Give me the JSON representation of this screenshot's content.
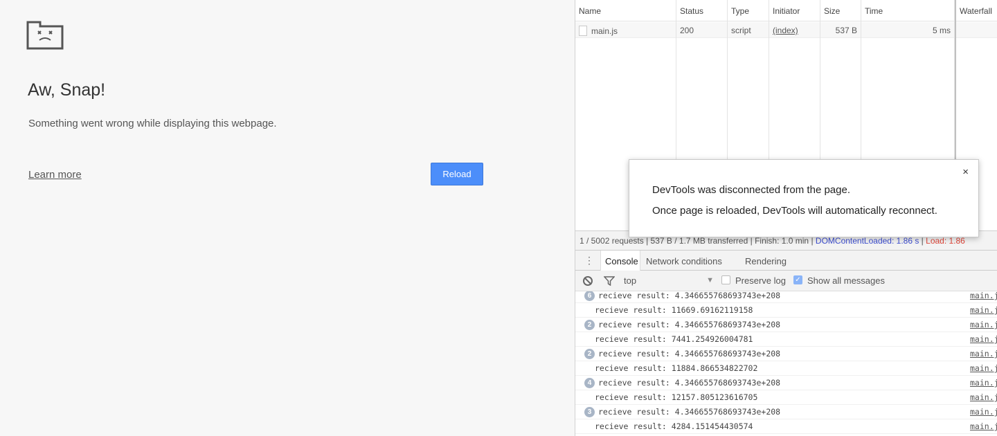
{
  "crash_page": {
    "title": "Aw, Snap!",
    "description": "Something went wrong while displaying this webpage.",
    "learn_more": "Learn more",
    "reload": "Reload"
  },
  "network": {
    "columns": {
      "name": "Name",
      "status": "Status",
      "type": "Type",
      "initiator": "Initiator",
      "size": "Size",
      "time": "Time",
      "waterfall": "Waterfall"
    },
    "rows": [
      {
        "name": "main.js",
        "status": "200",
        "type": "script",
        "initiator": "(index)",
        "size": "537 B",
        "time": "5 ms"
      }
    ],
    "summary": {
      "requests": "1 / 5002 requests",
      "transferred": "537 B / 1.7 MB transferred",
      "finish": "Finish: 1.0 min",
      "dom_content_loaded": "DOMContentLoaded: 1.86 s",
      "load": "Load: 1.86"
    }
  },
  "drawer": {
    "menu_icon": "⋮",
    "tabs": [
      "Console",
      "Network conditions",
      "Rendering"
    ],
    "active_tab": "Console"
  },
  "console_toolbar": {
    "context": "top",
    "context_arrow": "▼",
    "preserve_log": "Preserve log",
    "preserve_log_checked": false,
    "show_all_messages": "Show all messages",
    "show_all_messages_checked": true,
    "check_mark": "✓"
  },
  "console": {
    "messages": [
      {
        "count": "6",
        "text": "recieve result: 4.346655768693743e+208",
        "source": "main.js"
      },
      {
        "count": "",
        "text": "recieve result: 11669.69162119158",
        "source": "main.js"
      },
      {
        "count": "2",
        "text": "recieve result: 4.346655768693743e+208",
        "source": "main.js"
      },
      {
        "count": "",
        "text": "recieve result: 7441.254926004781",
        "source": "main.js"
      },
      {
        "count": "2",
        "text": "recieve result: 4.346655768693743e+208",
        "source": "main.js"
      },
      {
        "count": "",
        "text": "recieve result: 11884.866534822702",
        "source": "main.js"
      },
      {
        "count": "4",
        "text": "recieve result: 4.346655768693743e+208",
        "source": "main.js"
      },
      {
        "count": "",
        "text": "recieve result: 12157.805123616705",
        "source": "main.js"
      },
      {
        "count": "3",
        "text": "recieve result: 4.346655768693743e+208",
        "source": "main.js"
      },
      {
        "count": "",
        "text": "recieve result: 4284.151454430574",
        "source": "main.js"
      }
    ]
  },
  "dialog": {
    "close": "×",
    "message_1": "DevTools was disconnected from the page.",
    "message_2": "Once page is reloaded, DevTools will automatically reconnect."
  }
}
